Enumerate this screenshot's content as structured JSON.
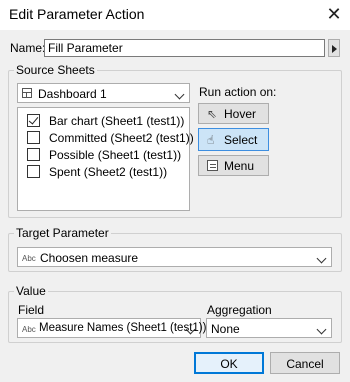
{
  "window": {
    "title": "Edit Parameter Action"
  },
  "name": {
    "label": "Name:",
    "value": "Fill Parameter"
  },
  "source_sheets": {
    "caption": "Source Sheets",
    "dashboard": "Dashboard 1",
    "items": [
      {
        "label": "Bar chart (Sheet1 (test1))",
        "checked": true
      },
      {
        "label": "Committed (Sheet2 (test1))",
        "checked": false
      },
      {
        "label": "Possible (Sheet1 (test1))",
        "checked": false
      },
      {
        "label": "Spent (Sheet2 (test1))",
        "checked": false
      }
    ]
  },
  "run_action": {
    "label": "Run action on:",
    "hover": "Hover",
    "select": "Select",
    "menu": "Menu",
    "selected": "Select"
  },
  "target_parameter": {
    "caption": "Target Parameter",
    "type_tag": "Abc",
    "value": "Choosen measure"
  },
  "value_group": {
    "caption": "Value",
    "field_label": "Field",
    "field_type_tag": "Abc",
    "field_value": "Measure Names (Sheet1 (test1))",
    "aggregation_label": "Aggregation",
    "aggregation_value": "None"
  },
  "buttons": {
    "ok": "OK",
    "cancel": "Cancel"
  },
  "colors": {
    "accent": "#0078d7",
    "selected_bg": "#cce4f7"
  }
}
